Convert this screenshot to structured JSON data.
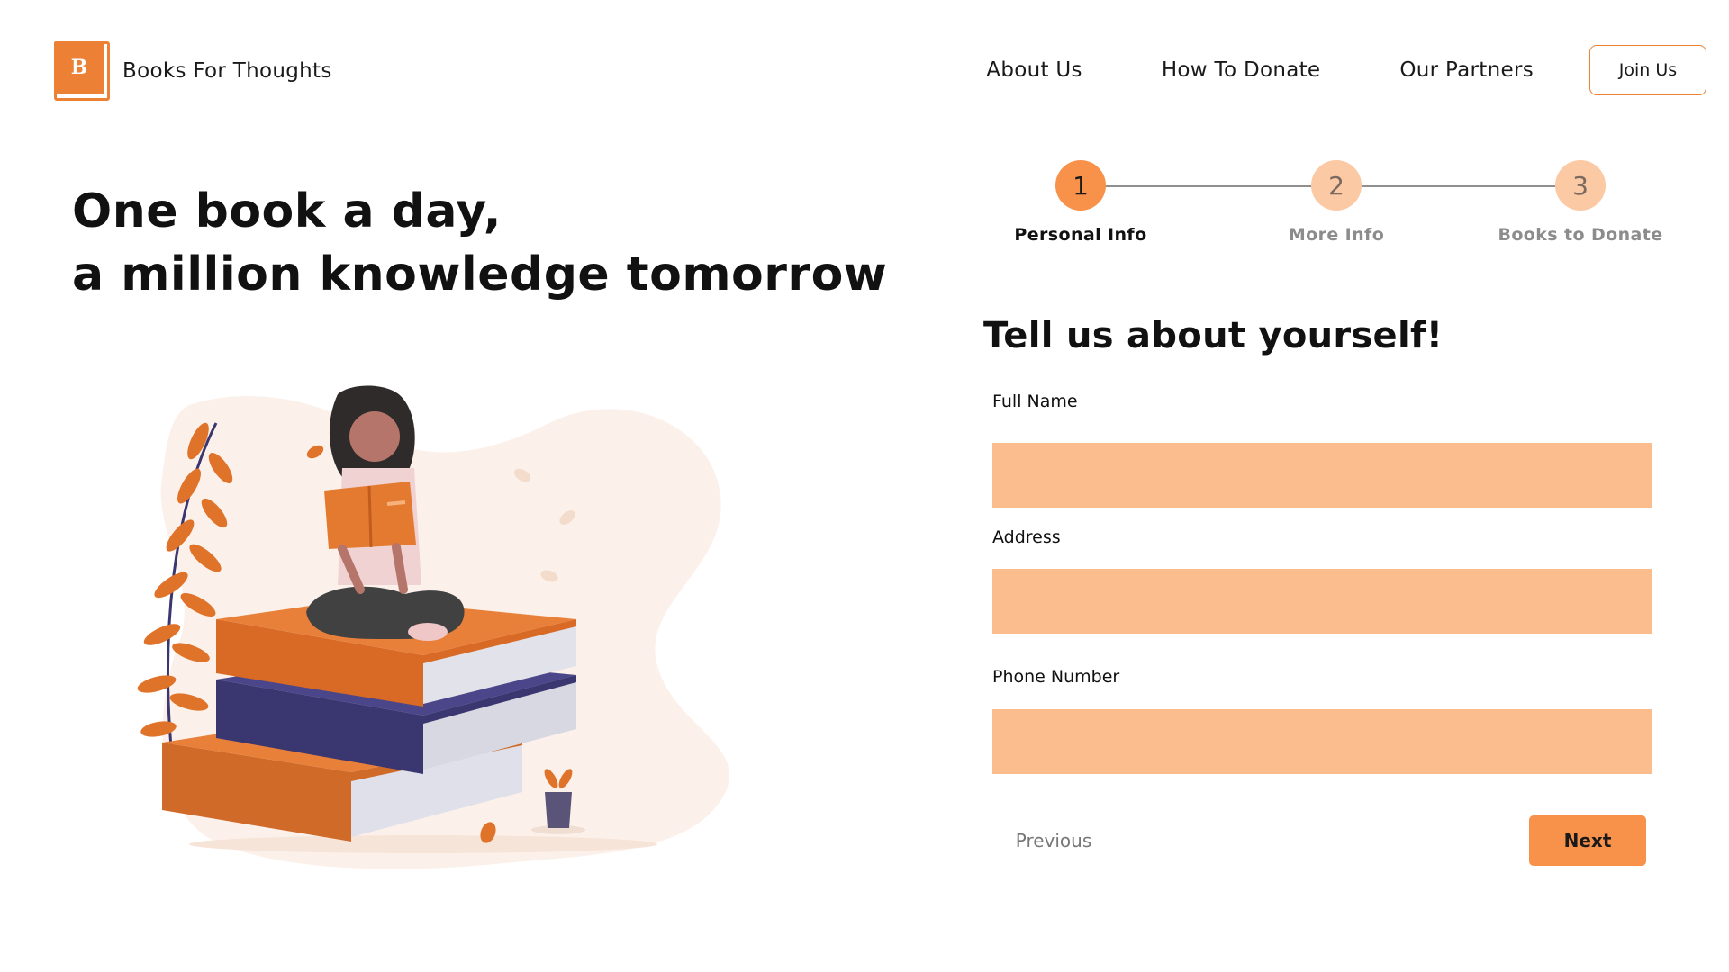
{
  "header": {
    "logo_letter": "B",
    "brand_name": "Books For Thoughts",
    "nav": [
      {
        "label": "About Us"
      },
      {
        "label": "How To Donate"
      },
      {
        "label": "Our Partners"
      }
    ],
    "join_label": "Join Us"
  },
  "hero": {
    "title_line1": "One book a day,",
    "title_line2": "a million knowledge tomorrow",
    "illustration_icon": "woman-reading-on-books-illustration"
  },
  "stepper": {
    "current_step": 1,
    "steps": [
      {
        "number": "1",
        "label": "Personal Info",
        "state": "active"
      },
      {
        "number": "2",
        "label": "More Info",
        "state": "inactive"
      },
      {
        "number": "3",
        "label": "Books to Donate",
        "state": "inactive"
      }
    ]
  },
  "form": {
    "title": "Tell us about yourself!",
    "fields": [
      {
        "label": "Full Name",
        "value": "",
        "placeholder": ""
      },
      {
        "label": "Address",
        "value": "",
        "placeholder": ""
      },
      {
        "label": "Phone Number",
        "value": "",
        "placeholder": ""
      }
    ],
    "previous_label": "Previous",
    "next_label": "Next"
  },
  "colors": {
    "accent": "#f8924a",
    "brand_orange": "#ec8035",
    "input_fill": "#fbbc8e",
    "step_inactive": "#fbc9a4",
    "book_navy": "#3a3670"
  }
}
